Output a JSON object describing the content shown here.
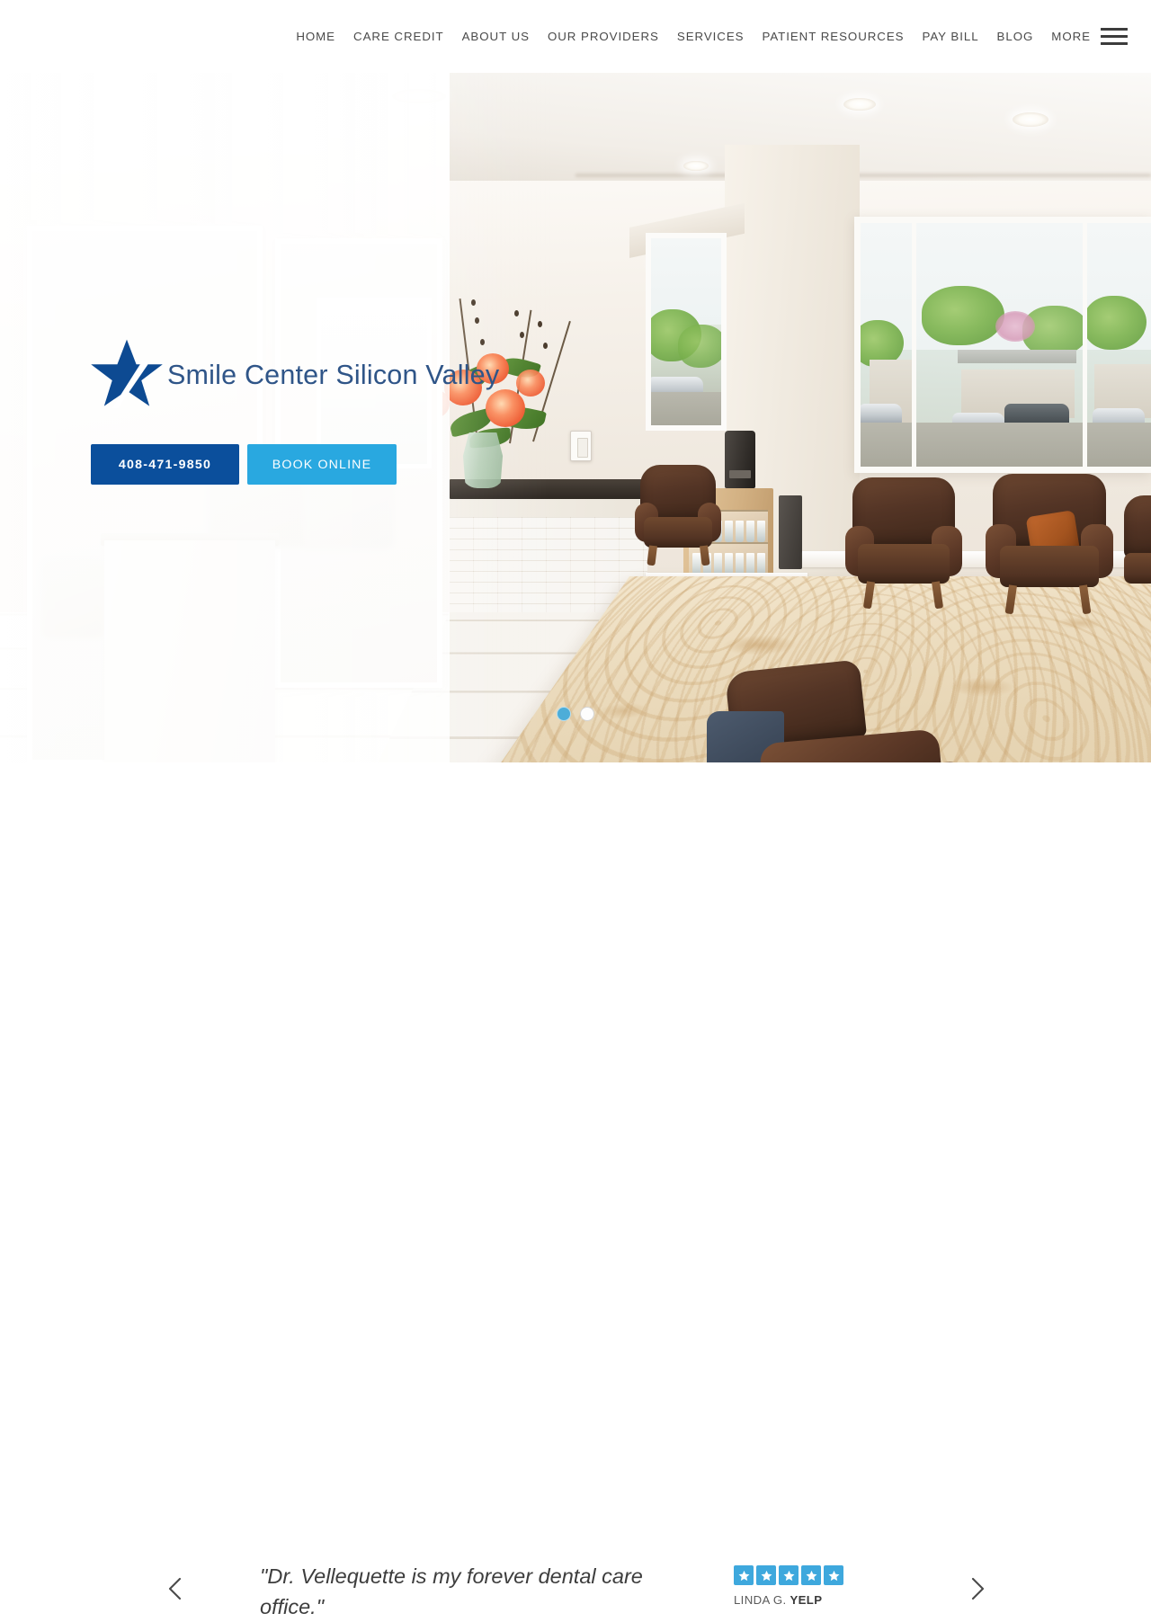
{
  "nav": {
    "items": [
      {
        "label": "HOME",
        "name": "nav-item-home"
      },
      {
        "label": "CARE CREDIT",
        "name": "nav-item-care-credit"
      },
      {
        "label": "ABOUT US",
        "name": "nav-item-about-us"
      },
      {
        "label": "OUR PROVIDERS",
        "name": "nav-item-our-providers"
      },
      {
        "label": "SERVICES",
        "name": "nav-item-services"
      },
      {
        "label": "PATIENT RESOURCES",
        "name": "nav-item-patient-resources"
      },
      {
        "label": "PAY BILL",
        "name": "nav-item-pay-bill"
      },
      {
        "label": "BLOG",
        "name": "nav-item-blog"
      }
    ],
    "more_label": "MORE",
    "menu_icon": "hamburger-menu-icon"
  },
  "hero": {
    "logo": {
      "text": "Smile Center Silicon Valley",
      "icon": "star-logo-icon",
      "color": "#2f5588",
      "star_color": "#0d4a92"
    },
    "buttons": {
      "phone": "408-471-9850",
      "book": "BOOK ONLINE",
      "phone_color": "#0b4f9c",
      "book_color": "#29a8e0"
    },
    "carousel": {
      "dots": [
        {
          "state": "active"
        },
        {
          "state": "inactive"
        }
      ],
      "active_color": "#4dadd8"
    },
    "image_alt": "Dental office reception and waiting room interior"
  },
  "testimonial": {
    "prev_icon": "chevron-left-icon",
    "next_icon": "chevron-right-icon",
    "quote": "\"Dr. Vellequette is my forever dental care office.\"",
    "rating": 5,
    "star_icon": "star-icon",
    "star_color": "#3ea8dd",
    "reviewer_name": "LINDA G.",
    "review_source": "YELP"
  }
}
